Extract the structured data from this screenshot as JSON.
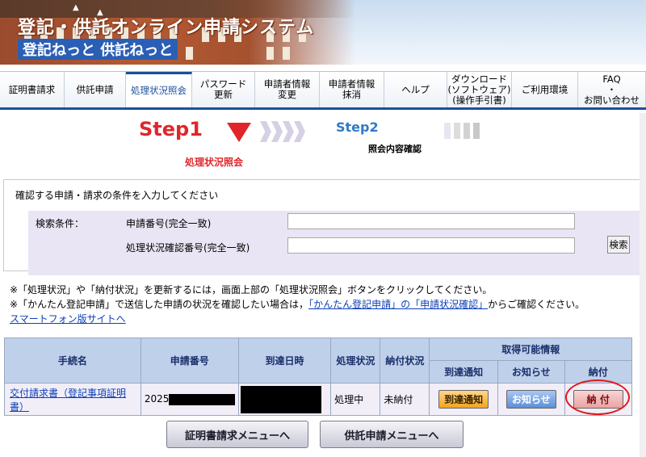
{
  "banner": {
    "title": "登記・供託オンライン申請システム",
    "subtitle": "登記ねっと 供託ねっと"
  },
  "nav": {
    "items": [
      {
        "label": "証明書請求",
        "width": 80,
        "active": false
      },
      {
        "label": "供託申請",
        "width": 76,
        "active": false
      },
      {
        "label": "処理状況照会",
        "width": 82,
        "active": true
      },
      {
        "label": "パスワード\n更新",
        "width": 78,
        "active": false
      },
      {
        "label": "申請者情報\n変更",
        "width": 80,
        "active": false
      },
      {
        "label": "申請者情報\n抹消",
        "width": 80,
        "active": false
      },
      {
        "label": "ヘルプ",
        "width": 78,
        "active": false
      },
      {
        "label": "ダウンロード\n(ソフトウェア)\n(操作手引書)",
        "width": 80,
        "active": false
      },
      {
        "label": "ご利用環境",
        "width": 82,
        "active": false
      },
      {
        "label": "FAQ\n・\nお問い合わせ",
        "width": 84,
        "active": false
      }
    ]
  },
  "steps": {
    "step1_label": "Step1",
    "step1_sub": "処理状況照会",
    "step2_label": "Step2",
    "step2_sub": "照会内容確認"
  },
  "search": {
    "title": "確認する申請・請求の条件を入力してください",
    "condition_label": "検索条件：",
    "field1_label": "申請番号(完全一致)",
    "field1_value": "",
    "field2_label": "処理状況確認番号(完全一致)",
    "field2_value": "",
    "button_label": "検索"
  },
  "notes": {
    "line1": "※「処理状況」や「納付状況」を更新するには，画面上部の「処理状況照会」ボタンをクリックしてください。",
    "line2_prefix": "※「かんたん登記申請」で送信した申請の状況を確認したい場合は，",
    "line2_link": "「かんたん登記申請」の「申請状況確認」",
    "line2_suffix": "からご確認ください。",
    "smartphone_link": "スマートフォン版サイトへ"
  },
  "table": {
    "headers": {
      "procedure": "手続名",
      "app_number": "申請番号",
      "arrival": "到達日時",
      "status": "処理状況",
      "payment_status": "納付状況",
      "available": "取得可能情報",
      "arrival_notice": "到達通知",
      "notice": "お知らせ",
      "payment": "納付"
    },
    "row": {
      "procedure": "交付請求書（登記事項証明書）",
      "app_number": "2025",
      "status": "処理中",
      "payment_status": "未納付",
      "arrival_btn": "到達通知",
      "notice_btn": "お知らせ",
      "payment_btn": "納 付"
    }
  },
  "buttons": {
    "cert_menu": "証明書請求メニューへ",
    "deposit_menu": "供託申請メニューへ"
  }
}
